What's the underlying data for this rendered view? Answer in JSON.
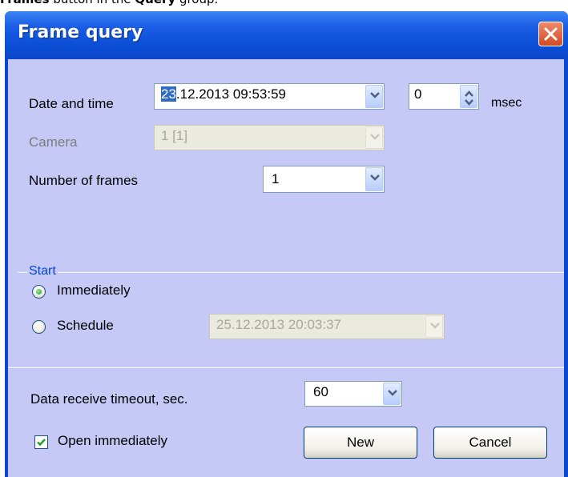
{
  "doc_text": {
    "prefix": "Frames",
    "middle": " button in the ",
    "group": "Query",
    "suffix": " group."
  },
  "window": {
    "title": "Frame query",
    "close_icon": "close-icon"
  },
  "form": {
    "datetime_label": "Date and time",
    "datetime_value_selected": "23",
    "datetime_value_rest": ".12.2013 09:53:59",
    "msec_value": "0",
    "msec_label": "msec",
    "camera_label": "Camera",
    "camera_value": "1 [1]",
    "frames_label": "Number of frames",
    "frames_value": "1"
  },
  "start_group": {
    "title": "Start",
    "immediately_label": "Immediately",
    "immediately_selected": true,
    "schedule_label": "Schedule",
    "schedule_value": "25.12.2013 20:03:37"
  },
  "footer": {
    "timeout_label": "Data receive timeout, sec.",
    "timeout_value": "60",
    "open_label": "Open immediately",
    "open_checked": true,
    "new_button": "New",
    "cancel_button": "Cancel"
  },
  "colors": {
    "title_bar": "#0a4fd6",
    "client_bg": "#c6c8f6",
    "group_title": "#0046d5",
    "close_button": "#d24a22"
  }
}
